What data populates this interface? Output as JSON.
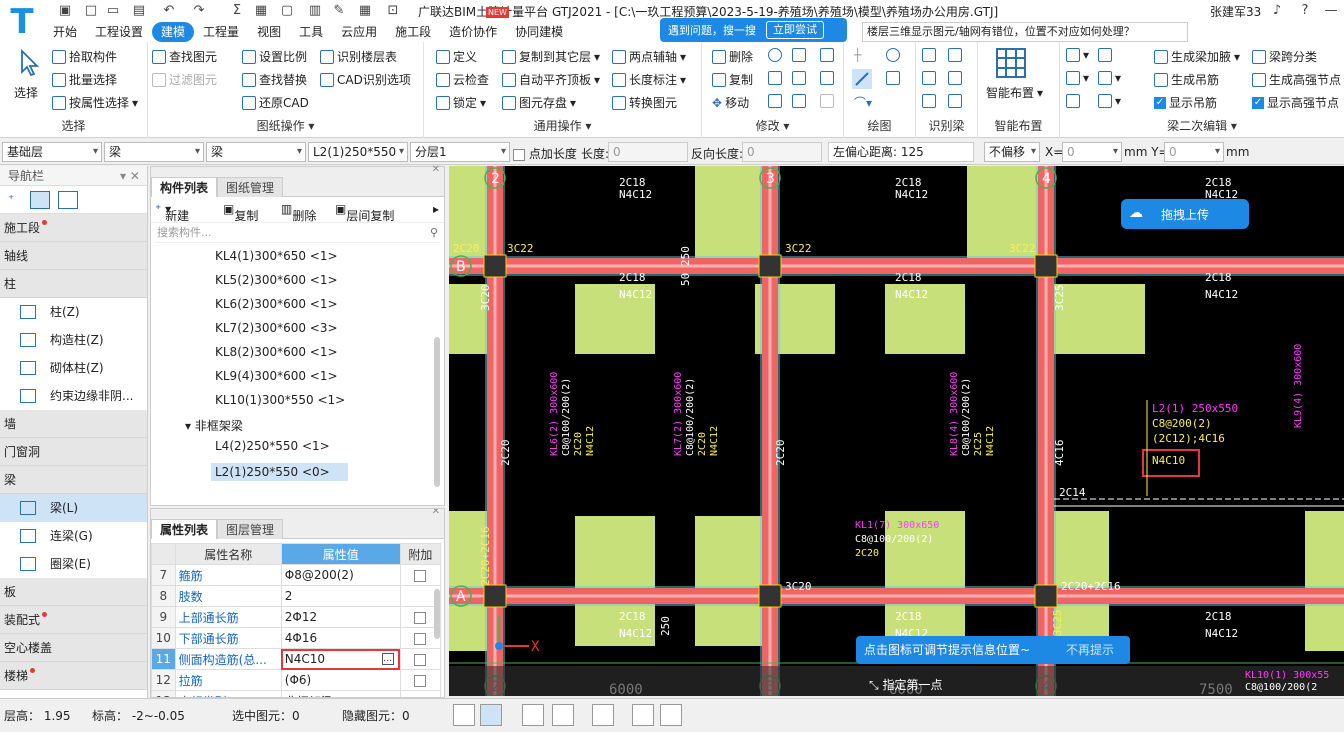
{
  "title_bar": {
    "app_title": "广联达BIM土建计量平台 GTJ2021 - [C:\\一玖工程预算\\2023-5-19-养殖场\\养殖场\\模型\\养殖场办公用房.GTJ]",
    "new_badge": "NEW",
    "username": "张建军33"
  },
  "menu_tabs": [
    "开始",
    "工程设置",
    "建模",
    "工程量",
    "视图",
    "工具",
    "云应用",
    "施工段",
    "造价协作",
    "协同建模"
  ],
  "active_tab": "建模",
  "search_popup": {
    "text": "遇到问题，搜一搜",
    "button": "立即尝试"
  },
  "question_box": "楼层三维显示图元/轴网有错位，位置不对应如何处理？",
  "ribbon": {
    "select": {
      "big": "选择",
      "items": [
        "拾取构件",
        "批量选择",
        "按属性选择"
      ],
      "label": "选择"
    },
    "drawing_ops": {
      "items": [
        "查找图元",
        "过滤图元",
        "设置比例",
        "查找替换",
        "还原CAD",
        "识别楼层表",
        "CAD识别选项"
      ],
      "label": "图纸操作"
    },
    "general_ops": {
      "items": [
        "定义",
        "云检查",
        "锁定",
        "复制到其它层",
        "自动平齐顶板",
        "图元存盘",
        "两点辅轴",
        "长度标注",
        "转换图元"
      ],
      "label": "通用操作"
    },
    "modify": {
      "items": [
        "删除",
        "复制",
        "移动"
      ],
      "label": "修改"
    },
    "draw": {
      "label": "绘图"
    },
    "recognize_beam": {
      "label": "识别梁"
    },
    "smart_layout": {
      "big": "智能布置",
      "label": "智能布置"
    },
    "beam_edit2": {
      "items": [
        "生成梁加腋",
        "生成吊筋",
        "显示吊筋",
        "梁跨分类",
        "生成高强节点",
        "显示高强节点"
      ],
      "label": "梁二次编辑"
    }
  },
  "prop_strip": {
    "floor": "基础层",
    "type1": "梁",
    "type2": "梁",
    "component": "L2(1)250*550",
    "layer": "分层1",
    "point_len_label": "点加长度",
    "length_label": "长度:",
    "length_val": "0",
    "rev_len_label": "反向长度:",
    "rev_len_val": "0",
    "offset": "左偏心距离: 125",
    "nooffset": "不偏移",
    "x_label": "X=",
    "x_val": "0",
    "y_label": "mm Y=",
    "y_val": "0",
    "mm": "mm"
  },
  "nav": {
    "header": "导航栏",
    "cats": [
      {
        "label": "施工段",
        "dot": true
      },
      {
        "label": "轴线",
        "dot": false
      },
      {
        "label": "柱",
        "dot": false
      }
    ],
    "col_items": [
      "柱(Z)",
      "构造柱(Z)",
      "砌体柱(Z)",
      "约束边缘非阴..."
    ],
    "cats2": [
      {
        "label": "墙",
        "dot": false
      },
      {
        "label": "门窗洞",
        "dot": false
      },
      {
        "label": "梁",
        "dot": false
      }
    ],
    "beam_items": [
      "梁(L)",
      "连梁(G)",
      "圈梁(E)"
    ],
    "cats3": [
      {
        "label": "板",
        "dot": false
      },
      {
        "label": "装配式",
        "dot": true
      },
      {
        "label": "空心楼盖",
        "dot": false
      },
      {
        "label": "楼梯",
        "dot": true
      }
    ]
  },
  "component_list": {
    "tabs": [
      "构件列表",
      "图纸管理"
    ],
    "tools": [
      "新建",
      "复制",
      "删除",
      "层间复制"
    ],
    "search_placeholder": "搜索构件...",
    "items": [
      "KL4(1)300*650 <1>",
      "KL5(2)300*600 <1>",
      "KL6(2)300*600 <1>",
      "KL7(2)300*600 <3>",
      "KL8(2)300*600 <1>",
      "KL9(4)300*600 <1>",
      "KL10(1)300*550 <1>"
    ],
    "group": "非框架梁",
    "sub_items": [
      "L4(2)250*550 <1>",
      "L2(1)250*550 <0>"
    ]
  },
  "attr_list": {
    "tabs": [
      "属性列表",
      "图层管理"
    ],
    "headers": [
      "属性名称",
      "属性值",
      "附加"
    ],
    "rows": [
      {
        "no": "7",
        "name": "箍筋",
        "value": "Φ8@200(2)",
        "check": true
      },
      {
        "no": "8",
        "name": "肢数",
        "value": "2",
        "check": false
      },
      {
        "no": "9",
        "name": "上部通长筋",
        "value": "2Φ12",
        "check": true
      },
      {
        "no": "10",
        "name": "下部通长筋",
        "value": "4Φ16",
        "check": true
      },
      {
        "no": "11",
        "name": "侧面构造筋(总...",
        "value": "N4C10",
        "check": true
      },
      {
        "no": "12",
        "name": "拉筋",
        "value": "(Φ6)",
        "check": true
      },
      {
        "no": "13",
        "name": "定额类别",
        "value": "非框架梁",
        "check": false
      }
    ]
  },
  "canvas": {
    "axes_top": [
      "2",
      "3",
      "4"
    ],
    "axes_left": [
      "B",
      "A"
    ],
    "upload_btn": "拖拽上传",
    "tip": "点击图标可调节提示信息位置~",
    "tip_close": "不再提示",
    "cmd": "指定第一点",
    "labels": {
      "n4c12": "N4C12",
      "c2c18": "2C18",
      "c2c20": "2C20",
      "c3c22": "3C22",
      "c3c20": "3C20",
      "c3c25": "3C25",
      "c2c14": "2C14",
      "c4c16": "4C16",
      "c2c20_2c16": "2C20+2C16",
      "c250": "250",
      "c50": "50",
      "c6000": "6000",
      "c7500": "7500",
      "kl6": "KL6(2) 300x600",
      "kl6b": "C8@100/200(2)",
      "kl6c": "2C20",
      "kl6d": "N4C12",
      "kl7": "KL7(2) 300x600",
      "kl8": "KL8(4) 300x600",
      "kl8c": "2C25",
      "kl9": "KL9(4) 300x600",
      "kl1": "KL1(7) 300x650",
      "kl1b": "C8@100/200(2)",
      "kl1c": "2C20",
      "l2": "L2(1) 250x550",
      "l2b": "C8@200(2)",
      "l2c": "(2C12);4C16",
      "l2d": "N4C10",
      "kl10": "KL10(1) 300x55",
      "kl10b": "C8@100/200(2",
      "x": "X"
    }
  },
  "status": {
    "floor_h": "层高： 1.95",
    "elev": "标高： -2~-0.05",
    "selected": "选中图元：0",
    "hidden": "隐藏图元：0"
  }
}
